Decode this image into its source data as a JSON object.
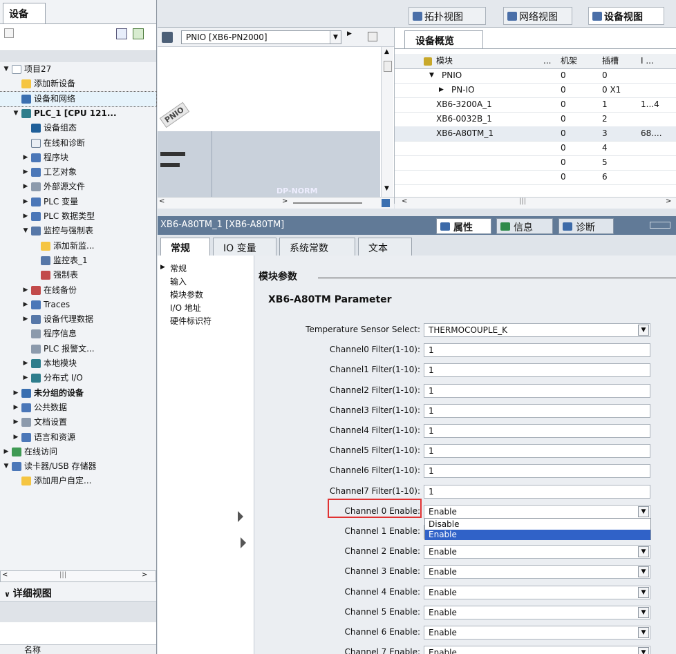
{
  "project_tree": {
    "tab_label": "设备",
    "items": [
      {
        "label": "项目27",
        "indent": 0,
        "arrow": "▼",
        "icon": "doc-icon"
      },
      {
        "label": "添加新设备",
        "indent": 1,
        "arrow": "",
        "icon": "add-device-icon"
      },
      {
        "label": "设备和网络",
        "indent": 1,
        "arrow": "",
        "icon": "network-icon",
        "selected": true
      },
      {
        "label": "PLC_1 [CPU 121...",
        "indent": 1,
        "arrow": "▼",
        "icon": "plc-icon",
        "bold": true
      },
      {
        "label": "设备组态",
        "indent": 2,
        "arrow": "",
        "icon": "device-config-icon"
      },
      {
        "label": "在线和诊断",
        "indent": 2,
        "arrow": "",
        "icon": "diagnostics-icon"
      },
      {
        "label": "程序块",
        "indent": 2,
        "arrow": "▶",
        "icon": "program-blocks-icon"
      },
      {
        "label": "工艺对象",
        "indent": 2,
        "arrow": "▶",
        "icon": "technology-objects-icon"
      },
      {
        "label": "外部源文件",
        "indent": 2,
        "arrow": "▶",
        "icon": "external-source-icon"
      },
      {
        "label": "PLC 变量",
        "indent": 2,
        "arrow": "▶",
        "icon": "plc-tags-icon"
      },
      {
        "label": "PLC 数据类型",
        "indent": 2,
        "arrow": "▶",
        "icon": "plc-datatypes-icon"
      },
      {
        "label": "监控与强制表",
        "indent": 2,
        "arrow": "▼",
        "icon": "watch-table-folder-icon"
      },
      {
        "label": "添加新监...",
        "indent": 3,
        "arrow": "",
        "icon": "add-watch-icon"
      },
      {
        "label": "监控表_1",
        "indent": 3,
        "arrow": "",
        "icon": "watch-table-icon"
      },
      {
        "label": "强制表",
        "indent": 3,
        "arrow": "",
        "icon": "force-table-icon"
      },
      {
        "label": "在线备份",
        "indent": 2,
        "arrow": "▶",
        "icon": "online-backup-icon"
      },
      {
        "label": "Traces",
        "indent": 2,
        "arrow": "▶",
        "icon": "traces-icon"
      },
      {
        "label": "设备代理数据",
        "indent": 2,
        "arrow": "▶",
        "icon": "device-proxy-icon"
      },
      {
        "label": "程序信息",
        "indent": 2,
        "arrow": "",
        "icon": "program-info-icon"
      },
      {
        "label": "PLC 报警文...",
        "indent": 2,
        "arrow": "",
        "icon": "plc-alarm-icon"
      },
      {
        "label": "本地模块",
        "indent": 2,
        "arrow": "▶",
        "icon": "local-modules-icon"
      },
      {
        "label": "分布式 I/O",
        "indent": 2,
        "arrow": "▶",
        "icon": "distributed-io-icon"
      },
      {
        "label": "未分组的设备",
        "indent": 1,
        "arrow": "▶",
        "icon": "ungrouped-devices-icon",
        "bold": true
      },
      {
        "label": "公共数据",
        "indent": 1,
        "arrow": "▶",
        "icon": "common-data-icon"
      },
      {
        "label": "文档设置",
        "indent": 1,
        "arrow": "▶",
        "icon": "document-settings-icon"
      },
      {
        "label": "语言和资源",
        "indent": 1,
        "arrow": "▶",
        "icon": "languages-icon"
      },
      {
        "label": "在线访问",
        "indent": 0,
        "arrow": "▶",
        "icon": "online-access-icon"
      },
      {
        "label": "读卡器/USB 存储器",
        "indent": 0,
        "arrow": "▼",
        "icon": "card-reader-icon"
      },
      {
        "label": "添加用户自定...",
        "indent": 1,
        "arrow": "",
        "icon": "add-user-defined-icon"
      }
    ],
    "detail_view_label": "详细视图",
    "detail_column_label": "名称"
  },
  "view_tabs": [
    {
      "label": "拓扑视图",
      "icon": "topology-view-icon"
    },
    {
      "label": "网络视图",
      "icon": "network-view-icon"
    },
    {
      "label": "设备视图",
      "icon": "device-view-icon",
      "active": true
    }
  ],
  "graphic": {
    "device_select": "PNIO [XB6-PN2000]",
    "device_tag": "PNIO",
    "module_text": "DP-NORM"
  },
  "overview": {
    "tab_label": "设备概览",
    "columns": [
      "模块",
      "...",
      "机架",
      "插槽",
      "I ..."
    ],
    "rows": [
      {
        "arrow": "▼",
        "module": "PNIO",
        "rack": "0",
        "slot": "0",
        "io": "",
        "indent": 0
      },
      {
        "arrow": "▶",
        "module": "PN-IO",
        "rack": "0",
        "slot": "0 X1",
        "io": "",
        "indent": 1
      },
      {
        "arrow": "",
        "module": "XB6-3200A_1",
        "rack": "0",
        "slot": "1",
        "io": "1...4",
        "indent": 0
      },
      {
        "arrow": "",
        "module": "XB6-0032B_1",
        "rack": "0",
        "slot": "2",
        "io": "",
        "indent": 0
      },
      {
        "arrow": "",
        "module": "XB6-A80TM_1",
        "rack": "0",
        "slot": "3",
        "io": "68....",
        "indent": 0,
        "selected": true
      },
      {
        "arrow": "",
        "module": "",
        "rack": "0",
        "slot": "4",
        "io": "",
        "indent": 0
      },
      {
        "arrow": "",
        "module": "",
        "rack": "0",
        "slot": "5",
        "io": "",
        "indent": 0
      },
      {
        "arrow": "",
        "module": "",
        "rack": "0",
        "slot": "6",
        "io": "",
        "indent": 0
      }
    ]
  },
  "inspector": {
    "title": "XB6-A80TM_1 [XB6-A80TM]",
    "tabs": [
      {
        "label": "属性",
        "icon": "properties-icon",
        "active": true
      },
      {
        "label": "信息",
        "icon": "info-icon"
      },
      {
        "label": "诊断",
        "icon": "diagnostics-tab-icon"
      }
    ],
    "prop_tabs": [
      {
        "label": "常规",
        "active": true
      },
      {
        "label": "IO 变量"
      },
      {
        "label": "系统常数"
      },
      {
        "label": "文本"
      }
    ],
    "nav": [
      {
        "label": "常规",
        "arrow": "▶"
      },
      {
        "label": "输入"
      },
      {
        "label": "模块参数",
        "selected": true
      },
      {
        "label": "I/O 地址"
      },
      {
        "label": "硬件标识符"
      }
    ]
  },
  "params": {
    "section_title": "模块参数",
    "sub_title": "XB6-A80TM Parameter",
    "fields": [
      {
        "label": "Temperature Sensor Select:",
        "value": "THERMOCOUPLE_K",
        "dropdown": true
      },
      {
        "label": "Channel0 Filter(1-10):",
        "value": "1"
      },
      {
        "label": "Channel1 Filter(1-10):",
        "value": "1"
      },
      {
        "label": "Channel2 Filter(1-10):",
        "value": "1"
      },
      {
        "label": "Channel3 Filter(1-10):",
        "value": "1"
      },
      {
        "label": "Channel4 Filter(1-10):",
        "value": "1"
      },
      {
        "label": "Channel5 Filter(1-10):",
        "value": "1"
      },
      {
        "label": "Channel6 Filter(1-10):",
        "value": "1"
      },
      {
        "label": "Channel7 Filter(1-10):",
        "value": "1"
      },
      {
        "label": "Channel 0 Enable:",
        "value": "Enable",
        "dropdown": true
      },
      {
        "label": "Channel 1 Enable:",
        "value": "Enable",
        "dropdown": true
      },
      {
        "label": "Channel 2 Enable:",
        "value": "Enable",
        "dropdown": true
      },
      {
        "label": "Channel 3 Enable:",
        "value": "Enable",
        "dropdown": true
      },
      {
        "label": "Channel 4 Enable:",
        "value": "Enable",
        "dropdown": true
      },
      {
        "label": "Channel 5 Enable:",
        "value": "Enable",
        "dropdown": true
      },
      {
        "label": "Channel 6 Enable:",
        "value": "Enable",
        "dropdown": true
      },
      {
        "label": "Channel 7 Enable:",
        "value": "Enable",
        "dropdown": true
      }
    ],
    "open_dropdown_options": [
      "Disable",
      "Enable"
    ],
    "open_dropdown_selected": "Enable"
  },
  "colors": {
    "inspector_bar": "#617a97",
    "highlight": "#e03232",
    "selection": "#3062c8"
  }
}
